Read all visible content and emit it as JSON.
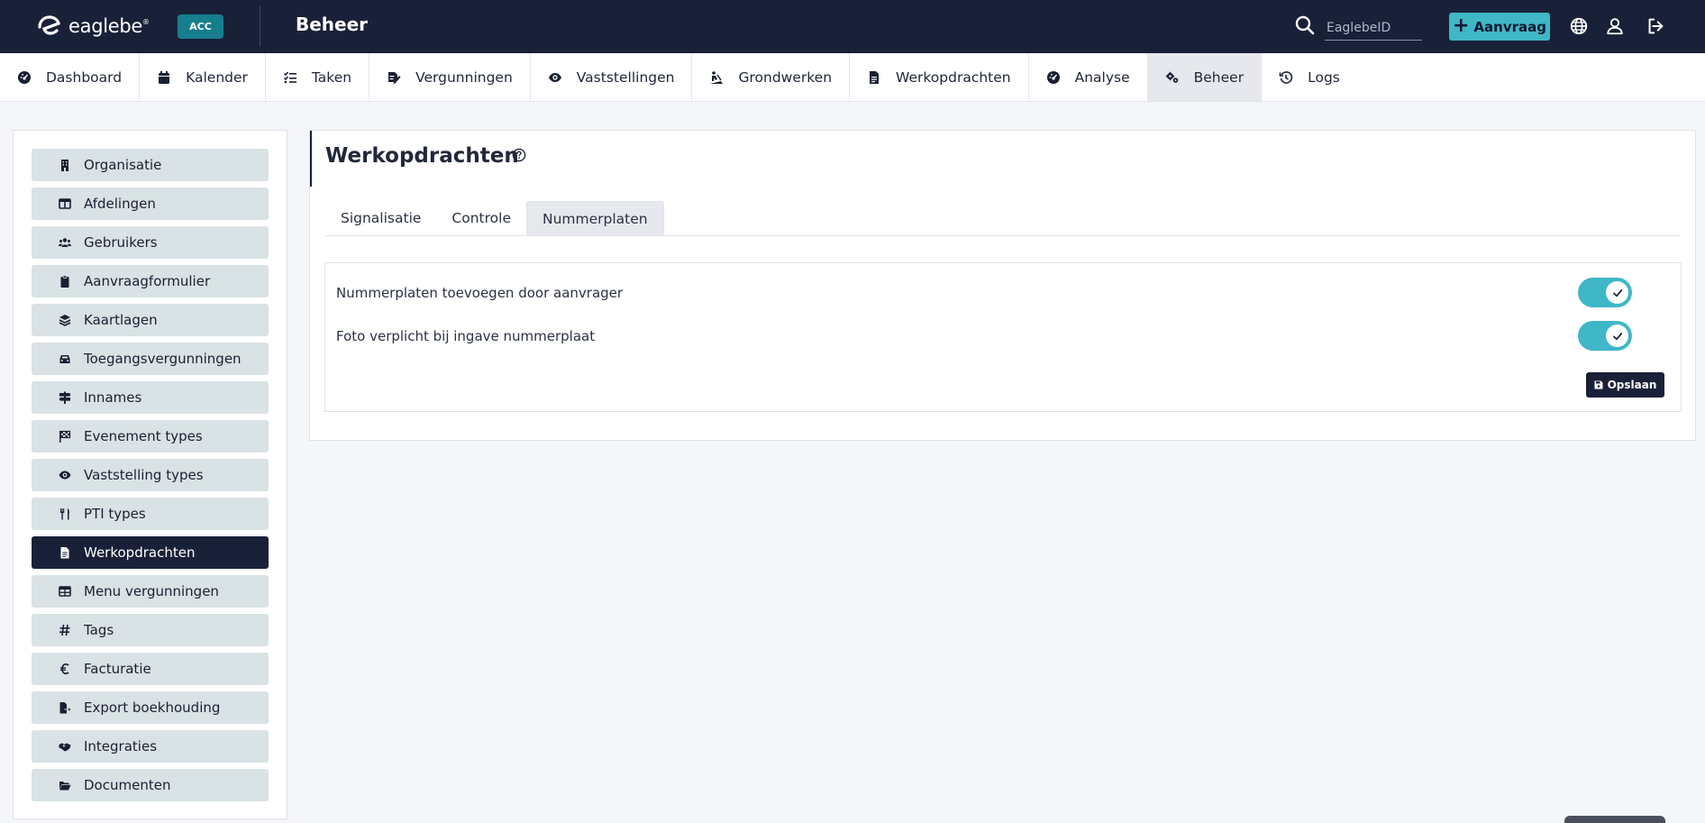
{
  "header": {
    "logo_text": "eaglebe",
    "logo_reg": "®",
    "env_badge": "ACC",
    "title": "Beheer",
    "search_placeholder": "EaglebeID",
    "search_value": "",
    "aanvraag_plus": "+",
    "aanvraag_label": "Aanvraag"
  },
  "nav": {
    "items": [
      {
        "label": "Dashboard",
        "icon": "dashboard-icon"
      },
      {
        "label": "Kalender",
        "icon": "calendar-icon"
      },
      {
        "label": "Taken",
        "icon": "tasks-icon"
      },
      {
        "label": "Vergunningen",
        "icon": "permit-icon"
      },
      {
        "label": "Vaststellingen",
        "icon": "eye-icon"
      },
      {
        "label": "Grondwerken",
        "icon": "digging-icon"
      },
      {
        "label": "Werkopdrachten",
        "icon": "document-icon"
      },
      {
        "label": "Analyse",
        "icon": "analysis-icon"
      },
      {
        "label": "Beheer",
        "icon": "cogs-icon",
        "active": true
      },
      {
        "label": "Logs",
        "icon": "history-icon"
      }
    ]
  },
  "sidebar": {
    "items": [
      {
        "label": "Organisatie",
        "icon": "building-icon"
      },
      {
        "label": "Afdelingen",
        "icon": "table-columns-icon"
      },
      {
        "label": "Gebruikers",
        "icon": "users-icon"
      },
      {
        "label": "Aanvraagformulier",
        "icon": "clipboard-icon"
      },
      {
        "label": "Kaartlagen",
        "icon": "layers-icon"
      },
      {
        "label": "Toegangsvergunningen",
        "icon": "car-icon"
      },
      {
        "label": "Innames",
        "icon": "signs-icon"
      },
      {
        "label": "Evenement types",
        "icon": "flag-checkered-icon"
      },
      {
        "label": "Vaststelling types",
        "icon": "eye-icon"
      },
      {
        "label": "PTI types",
        "icon": "utensils-icon"
      },
      {
        "label": "Werkopdrachten",
        "icon": "document-icon",
        "active": true
      },
      {
        "label": "Menu vergunningen",
        "icon": "table-icon"
      },
      {
        "label": "Tags",
        "icon": "hashtag-icon"
      },
      {
        "label": "Facturatie",
        "icon": "euro-icon"
      },
      {
        "label": "Export boekhouding",
        "icon": "file-export-icon"
      },
      {
        "label": "Integraties",
        "icon": "handshake-icon"
      },
      {
        "label": "Documenten",
        "icon": "folder-open-icon"
      }
    ]
  },
  "main": {
    "title": "Werkopdrachten",
    "tabs": [
      {
        "label": "Signalisatie"
      },
      {
        "label": "Controle"
      },
      {
        "label": "Nummerplaten",
        "active": true
      }
    ],
    "settings": [
      {
        "label": "Nummerplaten toevoegen door aanvrager",
        "enabled": true
      },
      {
        "label": "Foto verplicht bij ingave nummerplaat",
        "enabled": true
      }
    ],
    "save_label": "Opslaan"
  },
  "colors": {
    "header_bg": "#192139",
    "accent": "#3fb7c6",
    "badge": "#177e8e",
    "sidebar_item": "#d9e2e4",
    "active_dark": "#192139"
  }
}
